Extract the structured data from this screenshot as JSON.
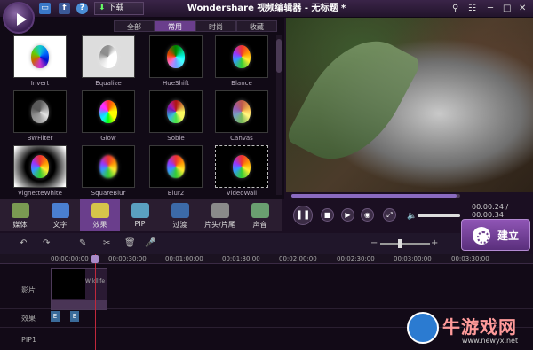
{
  "titlebar": {
    "title": "Wondershare 视频编辑器 - 无标题 *",
    "download_label": "下载",
    "icons": [
      "window-icon",
      "facebook-icon",
      "help-icon"
    ]
  },
  "category_tabs": [
    {
      "label": "全部",
      "active": false
    },
    {
      "label": "常用",
      "active": true
    },
    {
      "label": "时尚",
      "active": false
    },
    {
      "label": "收藏",
      "active": false
    }
  ],
  "filters": [
    {
      "label": "Invert"
    },
    {
      "label": "Equalize"
    },
    {
      "label": "HueShift"
    },
    {
      "label": "Blance"
    },
    {
      "label": "BWFilter"
    },
    {
      "label": "Glow"
    },
    {
      "label": "Soble"
    },
    {
      "label": "Canvas"
    },
    {
      "label": "VignetteWhite"
    },
    {
      "label": "SquareBlur"
    },
    {
      "label": "Blur2"
    },
    {
      "label": "VideoWall"
    }
  ],
  "toolbar": [
    {
      "label": "媒体",
      "active": false,
      "color": "#7a9a52"
    },
    {
      "label": "文字",
      "active": false,
      "color": "#4a7fd0"
    },
    {
      "label": "效果",
      "active": true,
      "color": "#d6c54a"
    },
    {
      "label": "PIP",
      "active": false,
      "color": "#5aa0c0"
    },
    {
      "label": "过渡",
      "active": false,
      "color": "#3c6aa8"
    },
    {
      "label": "片头/片尾",
      "active": false,
      "color": "#8a8a8a"
    },
    {
      "label": "声音",
      "active": false,
      "color": "#6aa070"
    }
  ],
  "player": {
    "time": "00:00:24 / 00:00:34",
    "progress_fraction": 0.98,
    "volume_fraction": 0.7
  },
  "create_button": {
    "label": "建立"
  },
  "ruler": [
    "00:00:00:00",
    "00:00:30:00",
    "00:01:00:00",
    "00:01:30:00",
    "00:02:00:00",
    "00:02:30:00",
    "00:03:00:00",
    "00:03:30:00"
  ],
  "tracks": {
    "video": "影片",
    "effect": "效果",
    "pip": "PIP1"
  },
  "clip": {
    "label": "Wildlife"
  },
  "effect_badge": "E",
  "watermark": {
    "text": "牛游戏网",
    "url": "www.newyx.net"
  }
}
